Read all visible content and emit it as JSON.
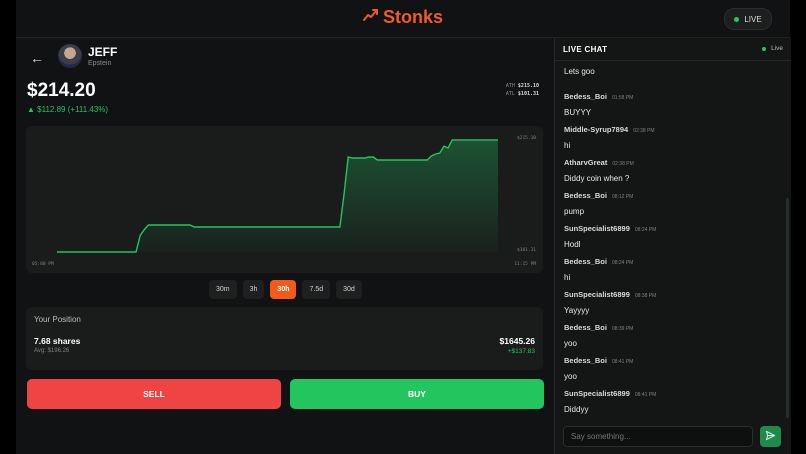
{
  "brand": {
    "name": "Stonks",
    "accent": "#ef5a2a",
    "icon": "trend-up-icon"
  },
  "status": {
    "live_label": "LIVE"
  },
  "stock": {
    "ticker": "JEFF",
    "name": "Epstein",
    "price": "$214.20",
    "change": "▲ $112.89 (+111.43%)",
    "ath_label": "ATH",
    "ath": "$215.10",
    "atl_label": "ATL",
    "atl": "$101.31"
  },
  "chart_data": {
    "type": "area",
    "x_labels": [
      "05:00 PM",
      "11:15 PM"
    ],
    "y_ticks": [
      "$215.10",
      "$101.31"
    ],
    "ylim": [
      101.31,
      215.1
    ],
    "values": [
      101.31,
      101.31,
      101.31,
      101.31,
      101.31,
      101.31,
      101.31,
      101.31,
      101.31,
      101.31,
      101.31,
      101.31,
      101.31,
      101.31,
      101.31,
      101.31,
      101.31,
      101.31,
      101.31,
      101.31,
      118,
      124,
      128.5,
      128.5,
      128.5,
      128.5,
      128.5,
      128.5,
      128.5,
      128.5,
      128.5,
      128.5,
      128.5,
      126.5,
      126.5,
      126.5,
      126.5,
      126.5,
      126.5,
      126.5,
      126.5,
      126.5,
      126.5,
      126.5,
      126.5,
      126.5,
      126.5,
      126.5,
      126.5,
      126.5,
      126.5,
      126.5,
      126.5,
      126.5,
      126.5,
      126.5,
      126.5,
      126.5,
      126.5,
      126.5,
      126.5,
      126.5,
      126.5,
      126.5,
      126.5,
      126.5,
      126.5,
      126.5,
      126.5,
      160,
      197,
      196,
      196,
      196,
      196,
      197,
      197,
      194,
      194,
      194,
      194,
      194,
      194,
      194,
      194,
      194,
      194,
      194,
      194,
      194,
      198,
      200,
      201,
      208,
      206,
      214.2,
      214.2,
      214.2,
      214.2,
      214.2,
      214.2,
      214.2,
      214.2,
      214.2,
      214.2,
      214.2,
      214.2
    ],
    "color": "#22c55e"
  },
  "ranges": [
    {
      "label": "30m",
      "active": false
    },
    {
      "label": "3h",
      "active": false
    },
    {
      "label": "30h",
      "active": true
    },
    {
      "label": "7.5d",
      "active": false
    },
    {
      "label": "30d",
      "active": false
    }
  ],
  "position": {
    "title": "Your Position",
    "shares": "7.68 shares",
    "avg": "Avg: $196.26",
    "value": "$1645.26",
    "gain": "+$137.83"
  },
  "actions": {
    "sell": "SELL",
    "buy": "BUY",
    "sell_color": "#ef4444",
    "buy_color": "#22c55e"
  },
  "chat": {
    "title": "LIVE CHAT",
    "live": "Live",
    "placeholder": "Say something...",
    "messages": [
      {
        "user": "",
        "time": "",
        "text": "Lets goo"
      },
      {
        "user": "Bedess_Boi",
        "time": "01:58 PM",
        "text": "BUYYY"
      },
      {
        "user": "Middle-Syrup7894",
        "time": "02:38 PM",
        "text": "hi"
      },
      {
        "user": "AtharvGreat",
        "time": "02:38 PM",
        "text": "Diddy coin when ?"
      },
      {
        "user": "Bedess_Boi",
        "time": "08:12 PM",
        "text": "pump"
      },
      {
        "user": "SunSpecialist6899",
        "time": "08:24 PM",
        "text": "Hodl"
      },
      {
        "user": "Bedess_Boi",
        "time": "08:24 PM",
        "text": "hi"
      },
      {
        "user": "SunSpecialist6899",
        "time": "08:38 PM",
        "text": "Yayyyy"
      },
      {
        "user": "Bedess_Boi",
        "time": "08:39 PM",
        "text": "yoo"
      },
      {
        "user": "Bedess_Boi",
        "time": "08:41 PM",
        "text": "yoo"
      },
      {
        "user": "SunSpecialist6899",
        "time": "08:41 PM",
        "text": "Diddyy"
      }
    ]
  }
}
